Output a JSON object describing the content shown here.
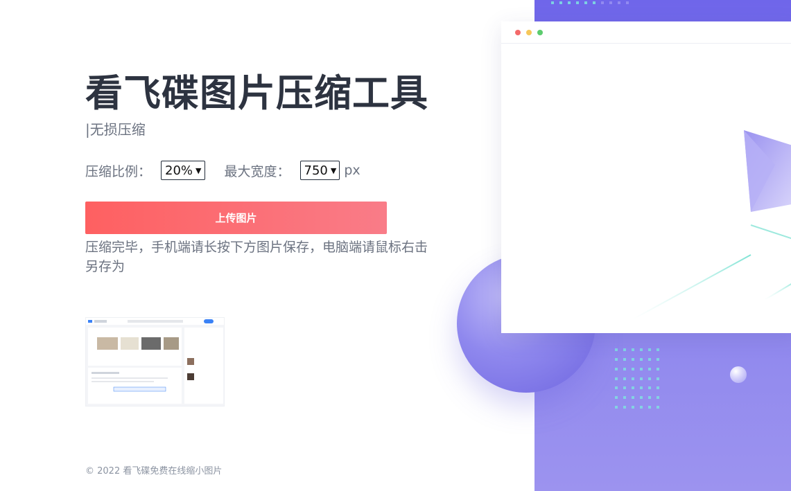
{
  "header": {
    "title": "看飞碟图片压缩工具",
    "subtitle": "|无损压缩"
  },
  "controls": {
    "ratio_label": "压缩比例：",
    "ratio_value": "20%",
    "width_label": "最大宽度：",
    "width_value": "750",
    "width_unit": "px"
  },
  "upload": {
    "button_label": "上传图片"
  },
  "result": {
    "message": "压缩完毕，手机端请长按下方图片保存，电脑端请鼠标右击另存为"
  },
  "footer": {
    "text": "© 2022 看飞碟免费在线缩小图片"
  },
  "colors": {
    "button_start": "#fe6061",
    "button_end": "#f97c88",
    "panel": "#6f66ea",
    "title": "#2d3340"
  }
}
